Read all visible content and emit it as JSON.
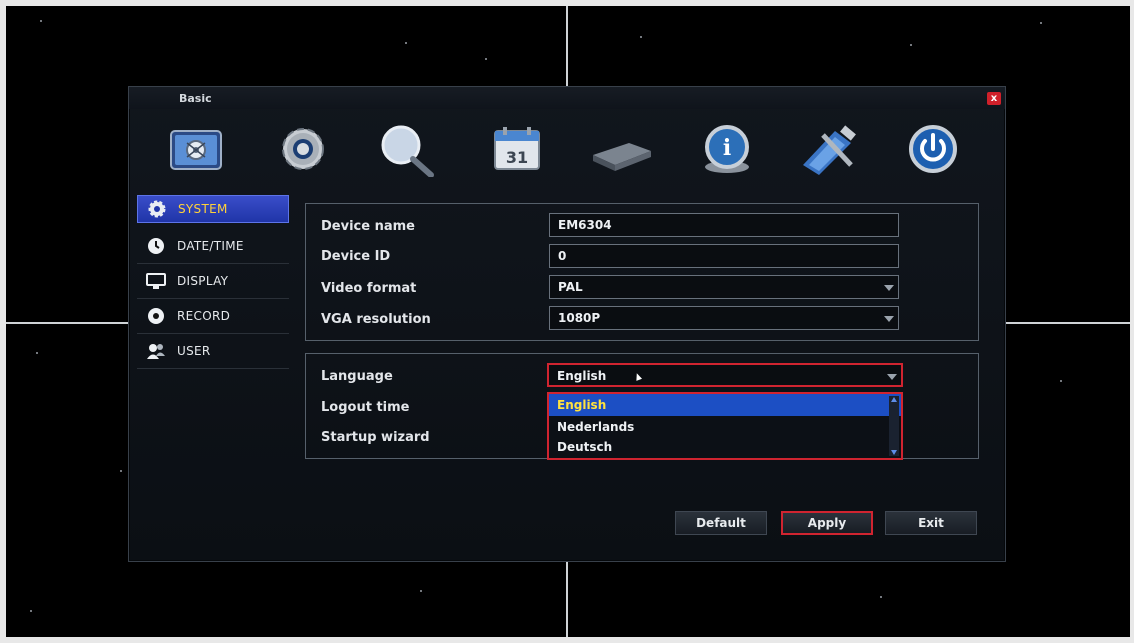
{
  "dialog": {
    "title": "Basic",
    "close_glyph": "x"
  },
  "toolbar": {
    "items": [
      {
        "icon": "basic-settings-icon"
      },
      {
        "icon": "gear-icon"
      },
      {
        "icon": "search-magnifier-icon"
      },
      {
        "icon": "calendar-icon",
        "text": "31"
      },
      {
        "icon": "hard-disk-icon"
      },
      {
        "icon": "info-icon",
        "text": "i"
      },
      {
        "icon": "tools-icon"
      },
      {
        "icon": "power-icon"
      }
    ]
  },
  "sidebar": {
    "items": [
      {
        "label": "SYSTEM",
        "icon": "gear-icon",
        "active": true
      },
      {
        "label": "DATE/TIME",
        "icon": "clock-icon"
      },
      {
        "label": "DISPLAY",
        "icon": "monitor-icon"
      },
      {
        "label": "RECORD",
        "icon": "record-icon"
      },
      {
        "label": "USER",
        "icon": "users-icon"
      }
    ]
  },
  "form": {
    "device_name_label": "Device name",
    "device_name_value": "EM6304",
    "device_id_label": "Device ID",
    "device_id_value": "0",
    "video_format_label": "Video format",
    "video_format_value": "PAL",
    "vga_resolution_label": "VGA resolution",
    "vga_resolution_value": "1080P",
    "language_label": "Language",
    "language_value": "English",
    "logout_time_label": "Logout time",
    "startup_wizard_label": "Startup wizard"
  },
  "language_dropdown": {
    "options": [
      "English",
      "Nederlands",
      "Deutsch"
    ],
    "selected": "English"
  },
  "buttons": {
    "default_label": "Default",
    "apply_label": "Apply",
    "exit_label": "Exit"
  },
  "colors": {
    "accent_selection": "#1c4fc4",
    "highlight_red": "#d02430",
    "active_sidebar_text": "#ffd23a"
  }
}
